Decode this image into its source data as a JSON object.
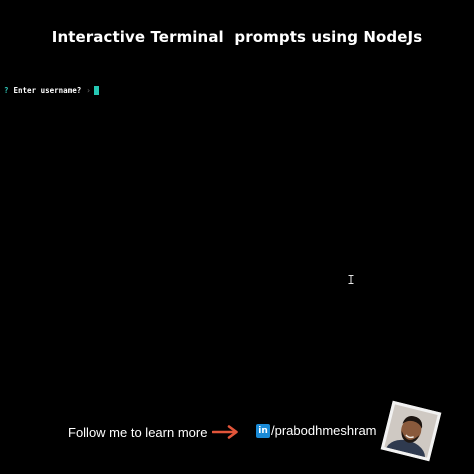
{
  "header": {
    "title": "Interactive Terminal  prompts using NodeJs"
  },
  "terminal": {
    "prompt_symbol": "?",
    "prompt_text": "Enter username?",
    "separator": "›",
    "input_value": "",
    "cursor_color": "#25c7b3",
    "prompt_symbol_color": "#2ec4b6"
  },
  "footer": {
    "follow_text": "Follow me to learn more",
    "linkedin_icon_text": "in",
    "handle": "/prabodhmeshram",
    "arrow_color": "#e2553a",
    "linkedin_color": "#1a8ad6"
  },
  "icons": {
    "mouse": "ibeam-cursor-icon",
    "arrow": "right-arrow-icon",
    "linkedin": "linkedin-icon",
    "avatar": "profile-avatar"
  }
}
